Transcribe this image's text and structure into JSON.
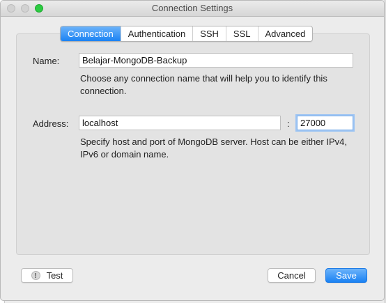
{
  "window": {
    "title": "Connection Settings"
  },
  "tabs": [
    {
      "label": "Connection",
      "active": true
    },
    {
      "label": "Authentication",
      "active": false
    },
    {
      "label": "SSH",
      "active": false
    },
    {
      "label": "SSL",
      "active": false
    },
    {
      "label": "Advanced",
      "active": false
    }
  ],
  "name": {
    "label": "Name:",
    "value": "Belajar-MongoDB-Backup",
    "help": "Choose any connection name that will help you to identify this connection."
  },
  "address": {
    "label": "Address:",
    "host": "localhost",
    "separator": ":",
    "port": "27000",
    "help": "Specify host and port of MongoDB server. Host can be either IPv4, IPv6 or domain name."
  },
  "buttons": {
    "test": "Test",
    "cancel": "Cancel",
    "save": "Save"
  },
  "colors": {
    "accent": "#1b82f3",
    "maximize": "#2ccb42"
  },
  "icons": {
    "test": "warning-icon"
  }
}
